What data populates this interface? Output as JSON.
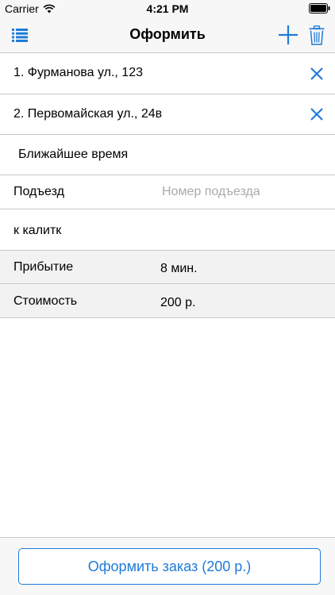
{
  "status_bar": {
    "carrier": "Carrier",
    "time": "4:21 PM"
  },
  "nav": {
    "title": "Оформить",
    "menu_icon": "list-icon",
    "add_icon": "plus-icon",
    "delete_icon": "trash-icon"
  },
  "route": {
    "points": [
      {
        "label": "1. Фурманова ул., 123"
      },
      {
        "label": "2. Первомайская ул., 24в"
      }
    ],
    "clear_icon": "close-icon"
  },
  "time_option": "Ближайшее время",
  "entrance": {
    "label": "Подъезд",
    "placeholder": "Номер подъезда",
    "value": ""
  },
  "comment": "к калитк",
  "summary": {
    "arrival": {
      "label": "Прибытие",
      "value": "8 мин."
    },
    "cost": {
      "label": "Стоимость",
      "value": "200 р."
    }
  },
  "order_button": {
    "label": "Оформить заказ (200 р.)"
  },
  "colors": {
    "accent": "#1f7bd8",
    "separator": "#c8c7cc",
    "bar_background": "#f7f7f7",
    "info_background": "#f2f2f2"
  }
}
